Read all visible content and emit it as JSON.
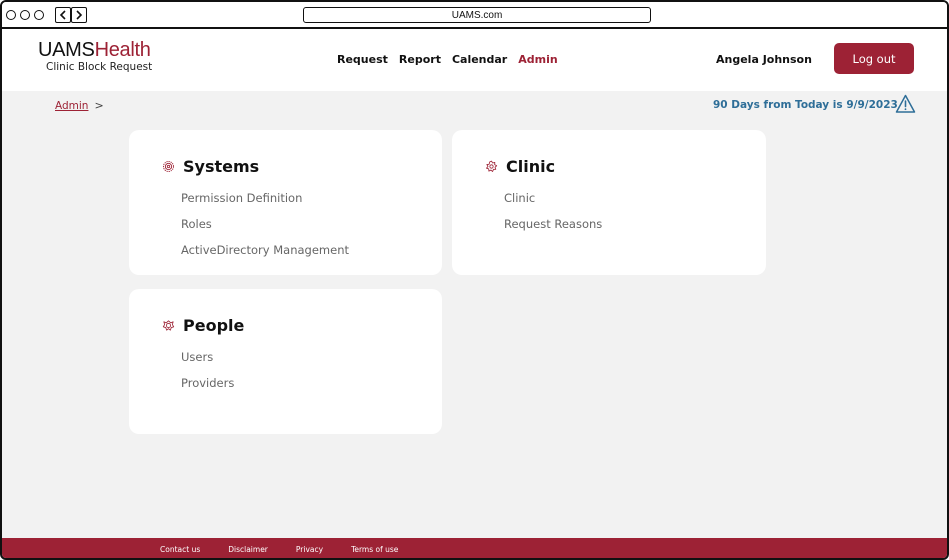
{
  "browser": {
    "url": "UAMS.com",
    "back_label": "‹",
    "forward_label": "›"
  },
  "header": {
    "logo_bold": "UAMS",
    "logo_light": "Health",
    "logo_sub": "Clinic Block Request",
    "nav": [
      {
        "label": "Request",
        "active": false
      },
      {
        "label": "Report",
        "active": false
      },
      {
        "label": "Calendar",
        "active": false
      },
      {
        "label": "Admin",
        "active": true
      }
    ],
    "user_name": "Angela Johnson",
    "logout_label": "Log out"
  },
  "breadcrumb": {
    "current": "Admin",
    "separator": ">"
  },
  "notice": {
    "text": "90 Days from Today is 9/9/2023",
    "icon": "warning-icon"
  },
  "cards": [
    {
      "title": "Systems",
      "icon": "gear-icon",
      "links": [
        "Permission Definition",
        "Roles",
        "ActiveDirectory Management"
      ]
    },
    {
      "title": "Clinic",
      "icon": "gear-icon",
      "links": [
        "Clinic",
        "Request Reasons"
      ]
    },
    {
      "title": "People",
      "icon": "gear-icon",
      "links": [
        "Users",
        "Providers"
      ]
    }
  ],
  "footer": {
    "links": [
      "Contact us",
      "Disclaimer",
      "Privacy",
      "Terms of use"
    ]
  },
  "colors": {
    "brand": "#9d2235",
    "notice": "#2e6e98",
    "page_bg": "#f2f2f2"
  }
}
